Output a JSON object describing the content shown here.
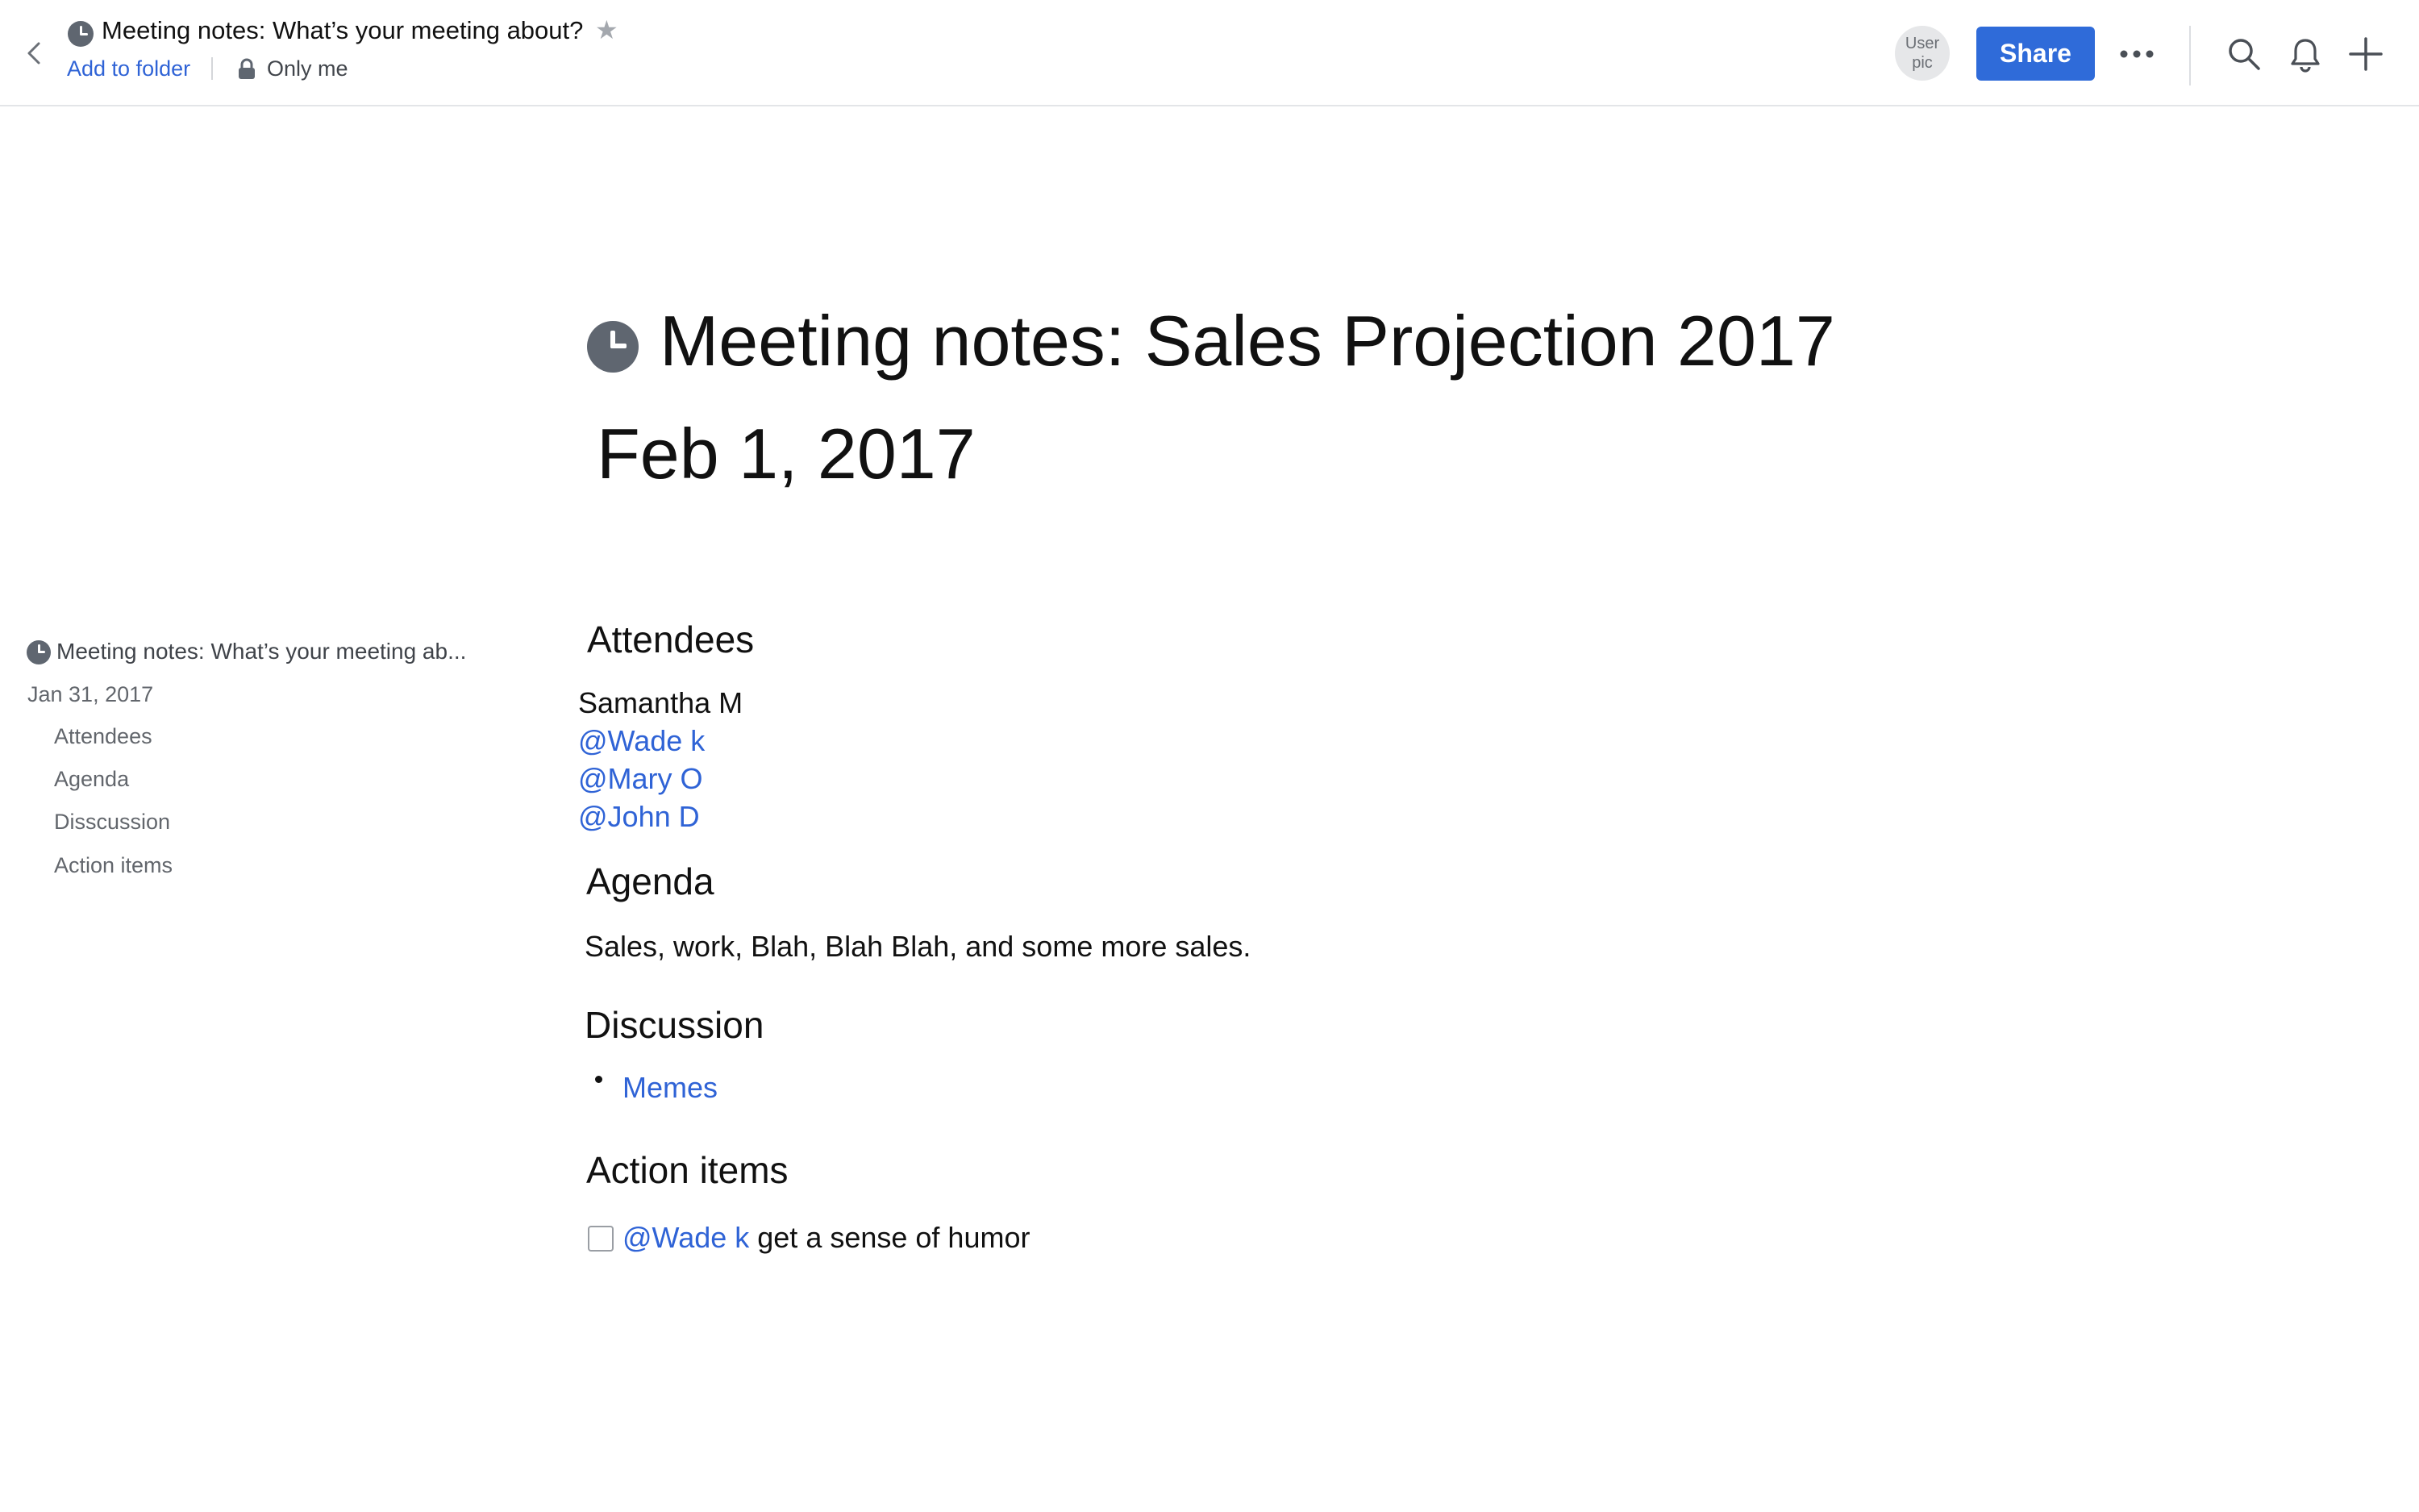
{
  "header": {
    "page_title": "Meeting notes: What’s your meeting about?",
    "add_to_folder": "Add to folder",
    "visibility": "Only me",
    "avatar_line1": "User",
    "avatar_line2": "pic",
    "share_label": "Share",
    "icons": [
      "back-chevron-icon",
      "clock-icon",
      "star-icon",
      "lock-icon",
      "more-icon",
      "search-icon",
      "bell-icon",
      "plus-icon"
    ]
  },
  "toc": {
    "title": "Meeting notes: What’s your meeting ab...",
    "date": "Jan 31, 2017",
    "items": [
      "Attendees",
      "Agenda",
      "Disscussion",
      "Action items"
    ]
  },
  "document": {
    "title": "Meeting notes: Sales Projection 2017",
    "date": "Feb 1, 2017",
    "attendees_heading": "Attendees",
    "attendees": [
      "Samantha M",
      "@Wade k",
      "@Mary O",
      "@John D"
    ],
    "agenda_heading": "Agenda",
    "agenda_text": "Sales, work, Blah, Blah Blah, and some more sales.",
    "discussion_heading": "Discussion",
    "discussion_items": [
      "Memes"
    ],
    "action_items_heading": "Action items",
    "action_item": {
      "mention": "@Wade k",
      "text": " get a sense of humor",
      "checked": false
    }
  },
  "colors": {
    "accent": "#2f6bd9",
    "mention": "#2f63d6",
    "icon_gray": "#5f6670"
  }
}
